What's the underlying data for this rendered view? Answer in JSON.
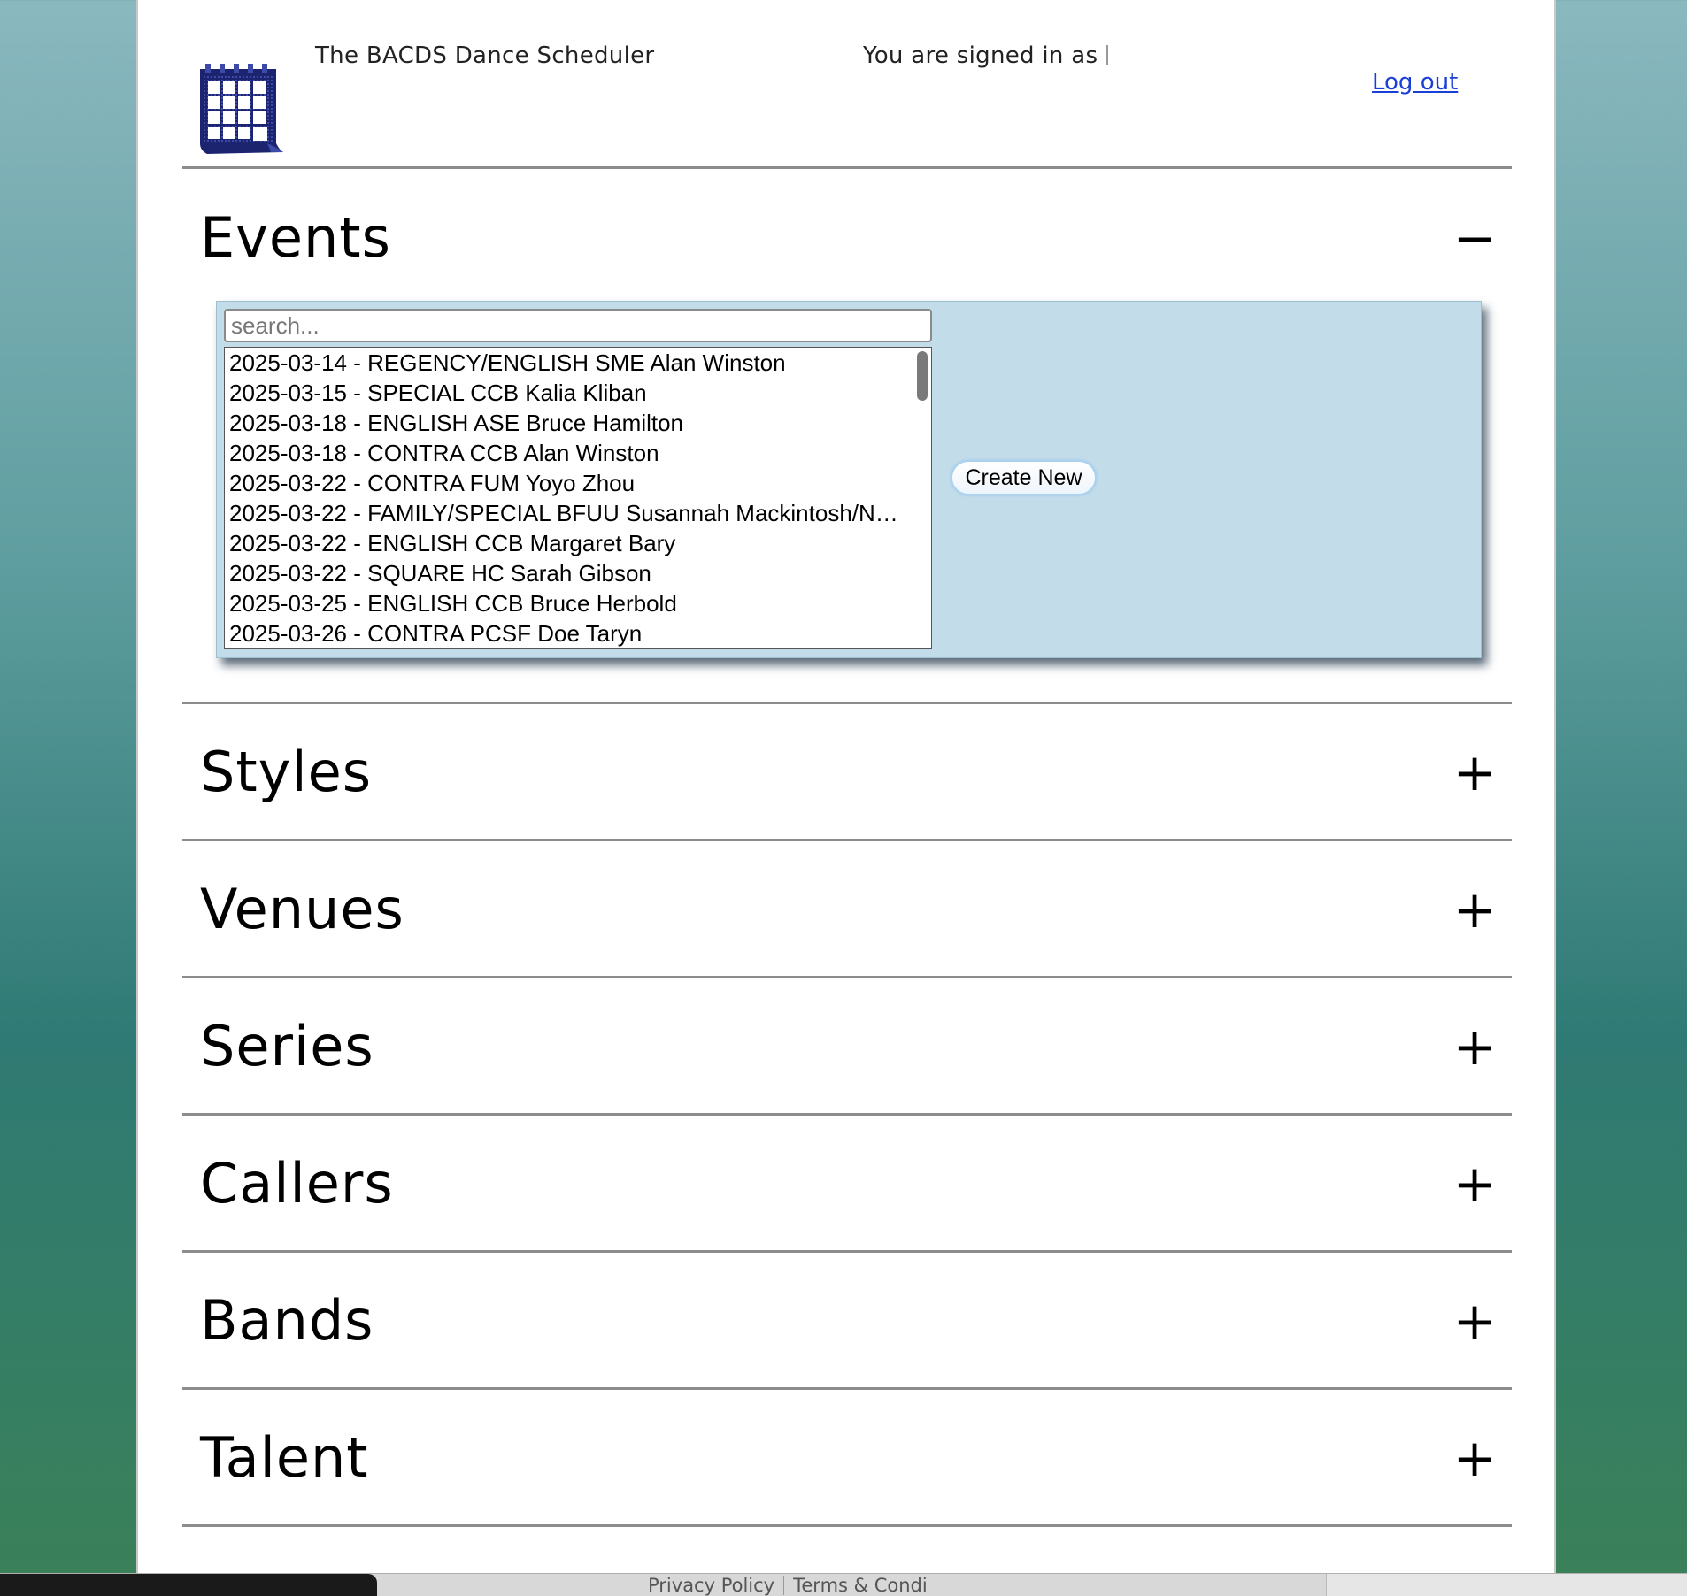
{
  "header": {
    "app_title": "The BACDS Dance Scheduler",
    "signed_in_text": "You are signed in as",
    "logout_label": "Log out",
    "logo_icon": "calendar-icon"
  },
  "events": {
    "title": "Events",
    "toggle": "−",
    "search_placeholder": "search...",
    "create_new_label": "Create New",
    "items": [
      "2025-03-14 - REGENCY/ENGLISH SME Alan Winston",
      "2025-03-15 - SPECIAL CCB Kalia Kliban",
      "2025-03-18 - ENGLISH ASE Bruce Hamilton",
      "2025-03-18 - CONTRA CCB Alan Winston",
      "2025-03-22 - CONTRA FUM Yoyo Zhou",
      "2025-03-22 - FAMILY/SPECIAL BFUU Susannah Mackintosh/N…",
      "2025-03-22 - ENGLISH CCB Margaret Bary",
      "2025-03-22 - SQUARE HC Sarah Gibson",
      "2025-03-25 - ENGLISH CCB Bruce Herbold",
      "2025-03-26 - CONTRA PCSF Doe Taryn"
    ]
  },
  "sections": [
    {
      "title": "Styles",
      "toggle": "+"
    },
    {
      "title": "Venues",
      "toggle": "+"
    },
    {
      "title": "Series",
      "toggle": "+"
    },
    {
      "title": "Callers",
      "toggle": "+"
    },
    {
      "title": "Bands",
      "toggle": "+"
    },
    {
      "title": "Talent",
      "toggle": "+"
    }
  ],
  "footer": {
    "privacy_label": "Privacy Policy",
    "terms_label": "Terms & Condi"
  },
  "colors": {
    "panel_bg": "#c3dcea",
    "link": "#1a3fd6",
    "rule": "#8c8c8c"
  }
}
